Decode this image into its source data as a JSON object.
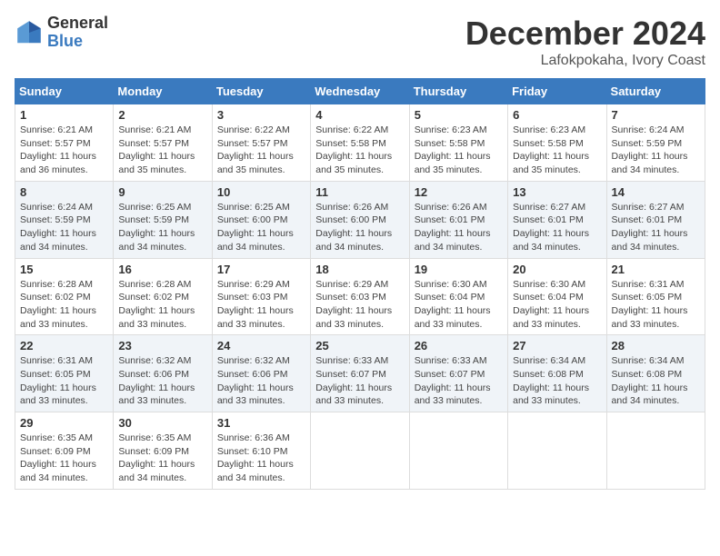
{
  "logo": {
    "general": "General",
    "blue": "Blue"
  },
  "calendar": {
    "title": "December 2024",
    "subtitle": "Lafokpokaha, Ivory Coast",
    "headers": [
      "Sunday",
      "Monday",
      "Tuesday",
      "Wednesday",
      "Thursday",
      "Friday",
      "Saturday"
    ],
    "weeks": [
      [
        {
          "day": "1",
          "info": "Sunrise: 6:21 AM\nSunset: 5:57 PM\nDaylight: 11 hours\nand 36 minutes."
        },
        {
          "day": "2",
          "info": "Sunrise: 6:21 AM\nSunset: 5:57 PM\nDaylight: 11 hours\nand 35 minutes."
        },
        {
          "day": "3",
          "info": "Sunrise: 6:22 AM\nSunset: 5:57 PM\nDaylight: 11 hours\nand 35 minutes."
        },
        {
          "day": "4",
          "info": "Sunrise: 6:22 AM\nSunset: 5:58 PM\nDaylight: 11 hours\nand 35 minutes."
        },
        {
          "day": "5",
          "info": "Sunrise: 6:23 AM\nSunset: 5:58 PM\nDaylight: 11 hours\nand 35 minutes."
        },
        {
          "day": "6",
          "info": "Sunrise: 6:23 AM\nSunset: 5:58 PM\nDaylight: 11 hours\nand 35 minutes."
        },
        {
          "day": "7",
          "info": "Sunrise: 6:24 AM\nSunset: 5:59 PM\nDaylight: 11 hours\nand 34 minutes."
        }
      ],
      [
        {
          "day": "8",
          "info": "Sunrise: 6:24 AM\nSunset: 5:59 PM\nDaylight: 11 hours\nand 34 minutes."
        },
        {
          "day": "9",
          "info": "Sunrise: 6:25 AM\nSunset: 5:59 PM\nDaylight: 11 hours\nand 34 minutes."
        },
        {
          "day": "10",
          "info": "Sunrise: 6:25 AM\nSunset: 6:00 PM\nDaylight: 11 hours\nand 34 minutes."
        },
        {
          "day": "11",
          "info": "Sunrise: 6:26 AM\nSunset: 6:00 PM\nDaylight: 11 hours\nand 34 minutes."
        },
        {
          "day": "12",
          "info": "Sunrise: 6:26 AM\nSunset: 6:01 PM\nDaylight: 11 hours\nand 34 minutes."
        },
        {
          "day": "13",
          "info": "Sunrise: 6:27 AM\nSunset: 6:01 PM\nDaylight: 11 hours\nand 34 minutes."
        },
        {
          "day": "14",
          "info": "Sunrise: 6:27 AM\nSunset: 6:01 PM\nDaylight: 11 hours\nand 34 minutes."
        }
      ],
      [
        {
          "day": "15",
          "info": "Sunrise: 6:28 AM\nSunset: 6:02 PM\nDaylight: 11 hours\nand 33 minutes."
        },
        {
          "day": "16",
          "info": "Sunrise: 6:28 AM\nSunset: 6:02 PM\nDaylight: 11 hours\nand 33 minutes."
        },
        {
          "day": "17",
          "info": "Sunrise: 6:29 AM\nSunset: 6:03 PM\nDaylight: 11 hours\nand 33 minutes."
        },
        {
          "day": "18",
          "info": "Sunrise: 6:29 AM\nSunset: 6:03 PM\nDaylight: 11 hours\nand 33 minutes."
        },
        {
          "day": "19",
          "info": "Sunrise: 6:30 AM\nSunset: 6:04 PM\nDaylight: 11 hours\nand 33 minutes."
        },
        {
          "day": "20",
          "info": "Sunrise: 6:30 AM\nSunset: 6:04 PM\nDaylight: 11 hours\nand 33 minutes."
        },
        {
          "day": "21",
          "info": "Sunrise: 6:31 AM\nSunset: 6:05 PM\nDaylight: 11 hours\nand 33 minutes."
        }
      ],
      [
        {
          "day": "22",
          "info": "Sunrise: 6:31 AM\nSunset: 6:05 PM\nDaylight: 11 hours\nand 33 minutes."
        },
        {
          "day": "23",
          "info": "Sunrise: 6:32 AM\nSunset: 6:06 PM\nDaylight: 11 hours\nand 33 minutes."
        },
        {
          "day": "24",
          "info": "Sunrise: 6:32 AM\nSunset: 6:06 PM\nDaylight: 11 hours\nand 33 minutes."
        },
        {
          "day": "25",
          "info": "Sunrise: 6:33 AM\nSunset: 6:07 PM\nDaylight: 11 hours\nand 33 minutes."
        },
        {
          "day": "26",
          "info": "Sunrise: 6:33 AM\nSunset: 6:07 PM\nDaylight: 11 hours\nand 33 minutes."
        },
        {
          "day": "27",
          "info": "Sunrise: 6:34 AM\nSunset: 6:08 PM\nDaylight: 11 hours\nand 33 minutes."
        },
        {
          "day": "28",
          "info": "Sunrise: 6:34 AM\nSunset: 6:08 PM\nDaylight: 11 hours\nand 34 minutes."
        }
      ],
      [
        {
          "day": "29",
          "info": "Sunrise: 6:35 AM\nSunset: 6:09 PM\nDaylight: 11 hours\nand 34 minutes."
        },
        {
          "day": "30",
          "info": "Sunrise: 6:35 AM\nSunset: 6:09 PM\nDaylight: 11 hours\nand 34 minutes."
        },
        {
          "day": "31",
          "info": "Sunrise: 6:36 AM\nSunset: 6:10 PM\nDaylight: 11 hours\nand 34 minutes."
        },
        {
          "day": "",
          "info": ""
        },
        {
          "day": "",
          "info": ""
        },
        {
          "day": "",
          "info": ""
        },
        {
          "day": "",
          "info": ""
        }
      ]
    ]
  }
}
